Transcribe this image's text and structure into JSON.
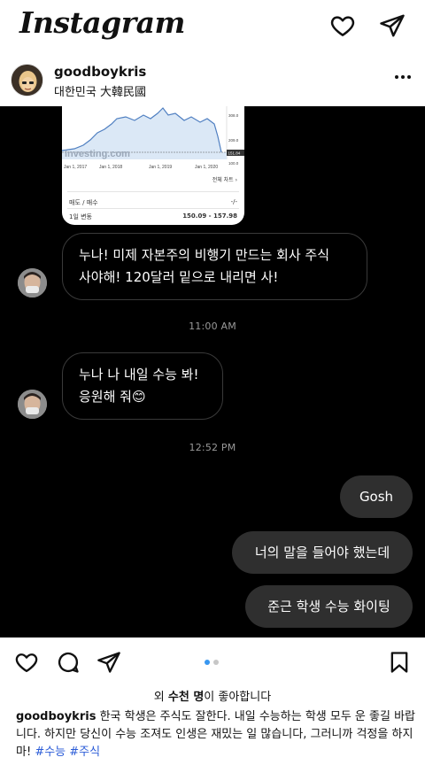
{
  "header": {
    "logo_text": "Instagram",
    "icons": [
      "heart-icon",
      "send-icon"
    ]
  },
  "post": {
    "username": "goodboykris",
    "location": "대한민국 大韓民國",
    "more_icon": "more-icon"
  },
  "shared_card": {
    "watermark": "Investing.com",
    "axis_labels": [
      "Jan 1, 2017",
      "Jan 1, 2018",
      "Jan 1, 2019",
      "Jan 1, 2020"
    ],
    "price_labels": [
      "308.0",
      "209.0",
      "151.84",
      "100.0"
    ],
    "full_chart_link": "전체 차트 ›",
    "row1_label": "매도 / 매수",
    "row1_value": "-/-",
    "row2_label": "1일 변동",
    "row2_value": "150.09 - 157.98"
  },
  "chat": {
    "messages": [
      {
        "dir": "in",
        "text_line1": "누나! 미제 자본주의 비행기 만드는 회사 주식",
        "text_line2": "사야해! 120달러 밑으로 내리면 사!"
      },
      {
        "dir": "time",
        "text": "11:00 AM"
      },
      {
        "dir": "in",
        "text_line1": "누나 나 내일 수능 봐!",
        "text_line2": "응원해 줘😊"
      },
      {
        "dir": "time",
        "text": "12:52 PM"
      },
      {
        "dir": "out",
        "text": "Gosh"
      },
      {
        "dir": "out",
        "text": "너의 말을 들어야 했는데"
      },
      {
        "dir": "out",
        "text": "준근 학생 수능 화이팅"
      }
    ]
  },
  "actions": {
    "icons": [
      "heart-icon",
      "comment-icon",
      "share-icon",
      "bookmark-icon"
    ],
    "carousel": {
      "count": 2,
      "active": 0,
      "active_color": "#3897f0",
      "inactive_color": "#c7c7c7"
    }
  },
  "likes": {
    "prefix": "외 ",
    "bold": "수천 명",
    "suffix": "이 좋아합니다"
  },
  "caption": {
    "username": "goodboykris",
    "text": " 한국 학생은 주식도 잘한다. 내일 수능하는 학생 모두 운 좋길 바랍니다. 하지만 당신이 수능 조져도 인생은 재밌는 일 많습니다, 그러니까 걱정을 하지 마! ",
    "hashtags": [
      "#수능",
      "#주식"
    ]
  }
}
